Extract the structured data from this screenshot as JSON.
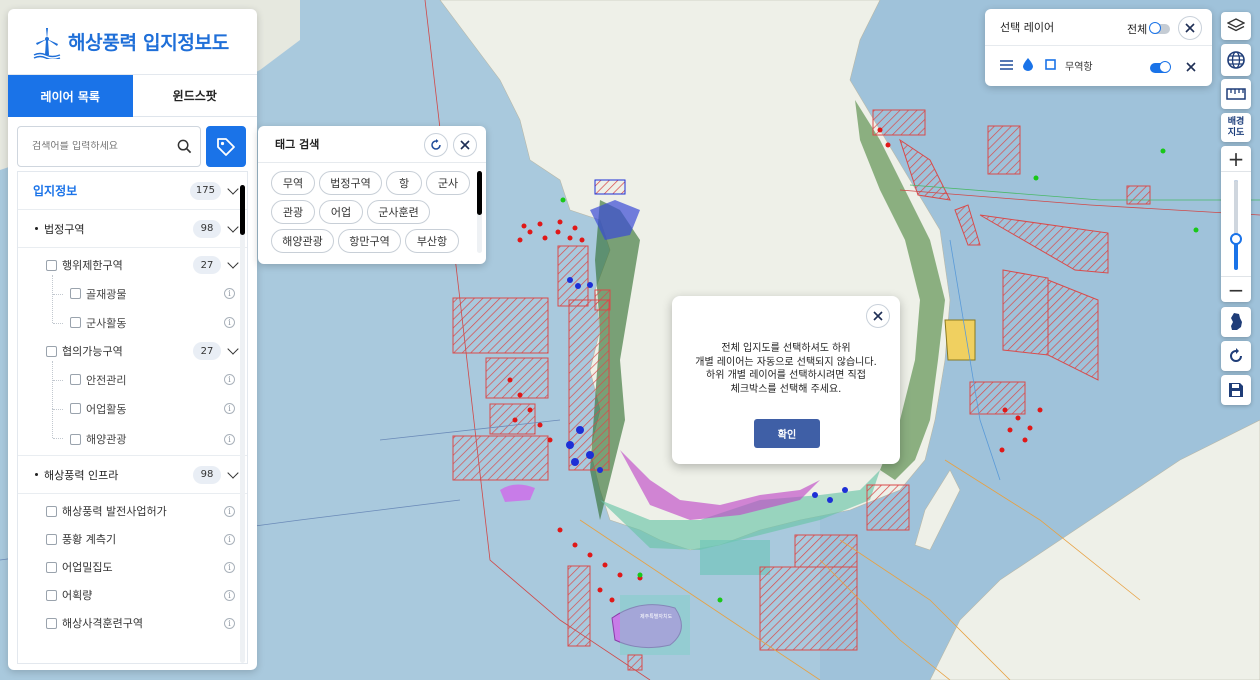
{
  "app": {
    "title": "해상풍력 입지정보도"
  },
  "tabs": [
    {
      "label": "레이어 목록",
      "active": true
    },
    {
      "label": "윈드스팟",
      "active": false
    }
  ],
  "search": {
    "placeholder": "검색어를 입력하세요"
  },
  "layer_tree": {
    "root": {
      "label": "입지정보",
      "count": "175"
    },
    "groups": [
      {
        "label": "법정구역",
        "count": "98",
        "subgroups": [
          {
            "label": "행위제한구역",
            "count": "27",
            "items": [
              "골재광물",
              "군사활동"
            ]
          },
          {
            "label": "협의가능구역",
            "count": "27",
            "items": [
              "안전관리",
              "어업활동",
              "해양관광"
            ]
          }
        ]
      },
      {
        "label": "해상풍력 인프라",
        "count": "98",
        "items": [
          "해상풍력 발전사업허가",
          "풍황 계측기",
          "어업밀집도",
          "어획량",
          "해상사격훈련구역"
        ]
      }
    ]
  },
  "tag_search": {
    "title": "태그 검색",
    "tags": [
      "무역",
      "법정구역",
      "항",
      "군사",
      "관광",
      "어업",
      "군사훈련",
      "해양관광",
      "항만구역",
      "부산항"
    ]
  },
  "selected_layers": {
    "title": "선택 레이어",
    "all_label": "전체",
    "all_toggle": false,
    "layers": [
      {
        "name": "무역항",
        "visible": true
      }
    ]
  },
  "toolbar": {
    "basemap_label": "배경\n지도",
    "zoom_in": "+",
    "zoom_out": "−",
    "zoom_level_fraction": 0.35
  },
  "dialog": {
    "lines": [
      "전체 입지도를 선택하셔도 하위",
      "개별 레이어는 자동으로 선택되지 않습니다.",
      "하위 개별 레이어를 선택하시려면 직접",
      "체크박스를 선택해 주세요."
    ],
    "confirm_label": "확인"
  },
  "map_labels": {
    "jeju": "제주특별자치도"
  },
  "colors": {
    "primary": "#1a73e8",
    "confirm_button": "#3f5fa6",
    "restricted_zone": "#d94a4a",
    "sea": "#a9c9dd",
    "land": "#eef0e8"
  }
}
